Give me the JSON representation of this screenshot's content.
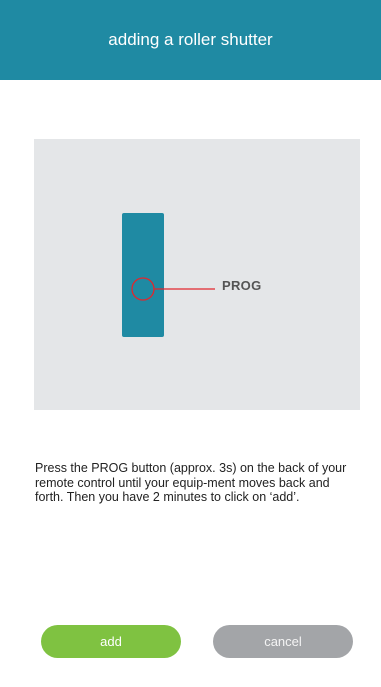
{
  "header": {
    "title": "adding a roller shutter"
  },
  "illustration": {
    "prog_label": "PROG"
  },
  "instructions": {
    "text": "Press the PROG button (approx. 3s) on the back of your remote control until your equip-ment moves back and forth. Then you have 2 minutes to click on ‘add’."
  },
  "actions": {
    "add_label": "add",
    "cancel_label": "cancel"
  },
  "colors": {
    "header_bg": "#1f8aa3",
    "remote": "#1f8aa3",
    "indicator": "#e2262d",
    "add_button": "#7fc241",
    "cancel_button": "#a3a5a8"
  }
}
